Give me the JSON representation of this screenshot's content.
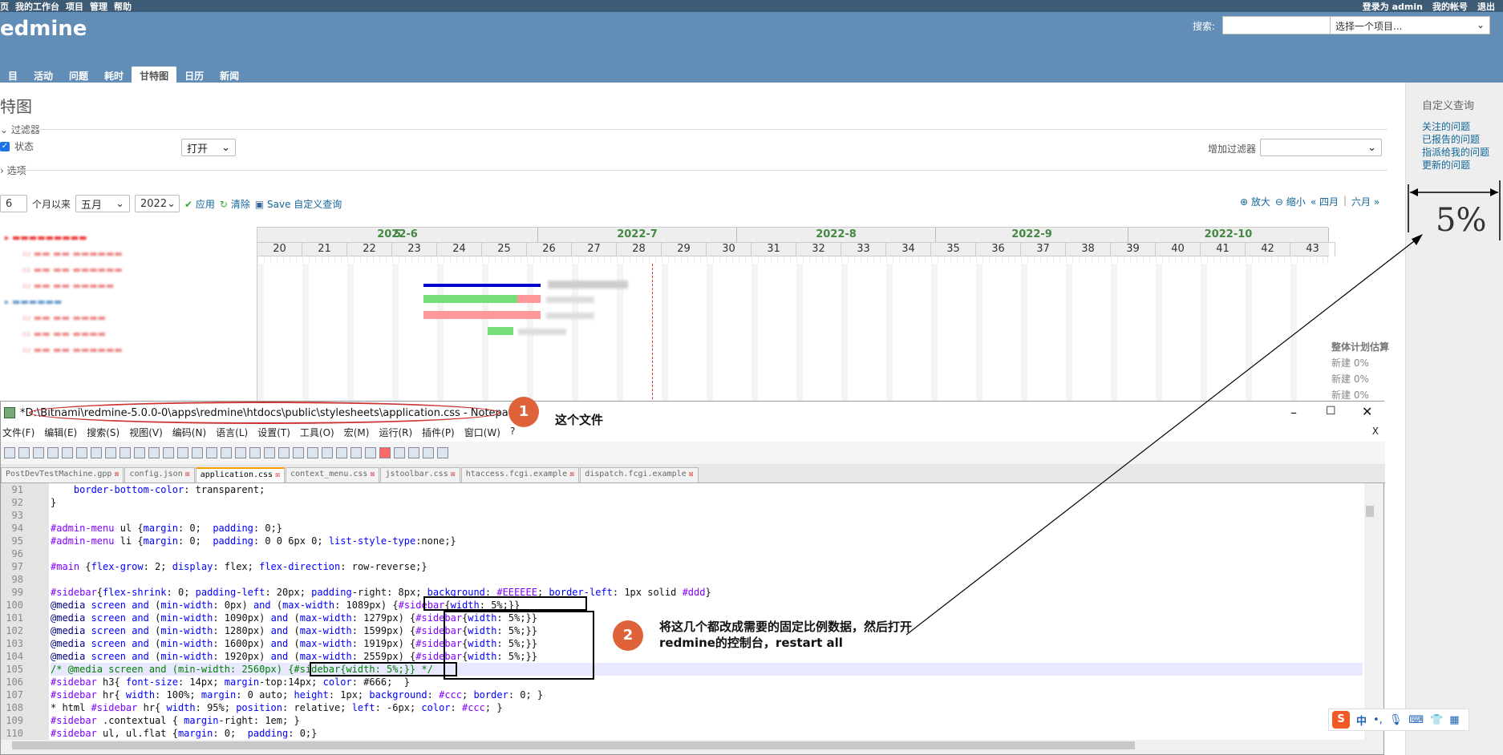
{
  "topbar": {
    "left_items": [
      "页",
      "我的工作台",
      "项目",
      "管理",
      "帮助"
    ],
    "login_prefix": "登录为",
    "user": "admin",
    "account": "我的帐号",
    "logout": "退出"
  },
  "header": {
    "brand": "edmine",
    "search_label": "搜索:",
    "project_select": "选择一个项目...",
    "tabs": [
      "目",
      "活动",
      "问题",
      "耗时",
      "甘特图",
      "日历",
      "新闻"
    ],
    "selected_tab": "甘特图"
  },
  "page": {
    "title": "特图",
    "filters_label": "过滤器",
    "status_label": "状态",
    "status_value": "打开",
    "add_filter_label": "增加过滤器",
    "options_label": "选项",
    "months_value": "6",
    "months_since": "个月以来",
    "month_select": "五月",
    "year_select": "2022",
    "apply": "应用",
    "clear": "清除",
    "save_query": "Save 自定义查询",
    "zoom_in": "放大",
    "zoom_out": "缩小",
    "prev_month": "« 四月",
    "next_month": "六月 »"
  },
  "sidebar": {
    "title": "自定义查询",
    "links": [
      "关注的问题",
      "已报告的问题",
      "指派给我的问题",
      "更新的问题"
    ]
  },
  "gantt": {
    "months": [
      "5",
      "2022-6",
      "2022-7",
      "2022-8",
      "2022-9",
      "2022-10"
    ],
    "weeks": [
      "20",
      "21",
      "22",
      "23",
      "24",
      "25",
      "26",
      "27",
      "28",
      "29",
      "30",
      "31",
      "32",
      "33",
      "34",
      "35",
      "36",
      "37",
      "38",
      "39",
      "40",
      "41",
      "42",
      "43"
    ],
    "version_label": "整体计划估算",
    "new_labels": [
      "新建 0%",
      "新建 0%",
      "新建 0%"
    ]
  },
  "npp": {
    "title": "*D:\\Bitnami\\redmine-5.0.0-0\\apps\\redmine\\htdocs\\public\\stylesheets\\application.css - Notepad++",
    "menu": [
      "文件(F)",
      "编辑(E)",
      "搜索(S)",
      "视图(V)",
      "编码(N)",
      "语言(L)",
      "设置(T)",
      "工具(O)",
      "宏(M)",
      "运行(R)",
      "插件(P)",
      "窗口(W)",
      "?"
    ],
    "close_x": "X",
    "tabs": [
      "PostDevTestMachine.gpp",
      "config.json",
      "application.css",
      "context_menu.css",
      "jstoolbar.css",
      "htaccess.fcgi.example",
      "dispatch.fcgi.example"
    ],
    "active_tab": "application.css",
    "line_numbers": [
      "91",
      "92",
      "93",
      "94",
      "95",
      "96",
      "97",
      "98",
      "99",
      "100",
      "101",
      "102",
      "103",
      "104",
      "105",
      "106",
      "107",
      "108",
      "109",
      "110"
    ],
    "lines": [
      "    border-bottom-color: transparent;",
      "}",
      "",
      "#admin-menu ul {margin: 0;  padding: 0;}",
      "#admin-menu li {margin: 0;  padding: 0 0 6px 0; list-style-type:none;}",
      "",
      "#main {flex-grow: 2; display: flex; flex-direction: row-reverse;}",
      "",
      "#sidebar{flex-shrink: 0; padding-left: 20px; padding-right: 8px; background: #EEEEEE; border-left: 1px solid #ddd}",
      "@media screen and (min-width: 0px) and (max-width: 1089px) {#sidebar{width: 5%;}}",
      "@media screen and (min-width: 1090px) and (max-width: 1279px) {#sidebar{width: 5%;}}",
      "@media screen and (min-width: 1280px) and (max-width: 1599px) {#sidebar{width: 5%;}}",
      "@media screen and (min-width: 1600px) and (max-width: 1919px) {#sidebar{width: 5%;}}",
      "@media screen and (min-width: 1920px) and (max-width: 2559px) {#sidebar{width: 5%;}}",
      "/* @media screen and (min-width: 2560px) {#sidebar{width: 5%;}} */",
      "#sidebar h3{ font-size: 14px; margin-top:14px; color: #666;  }",
      "#sidebar hr{ width: 100%; margin: 0 auto; height: 1px; background: #ccc; border: 0; }",
      "* html #sidebar hr{ width: 95%; position: relative; left: -6px; color: #ccc; }",
      "#sidebar .contextual { margin-right: 1em; }",
      "#sidebar ul, ul.flat {margin: 0;  padding: 0;}"
    ]
  },
  "annotations": {
    "one": "1",
    "one_text": "这个文件",
    "two": "2",
    "two_text": "将这几个都改成需要的固定比例数据，然后打开redmine的控制台，restart all",
    "handwritten": "5%"
  },
  "ime": {
    "s": "S",
    "zh": "中"
  }
}
